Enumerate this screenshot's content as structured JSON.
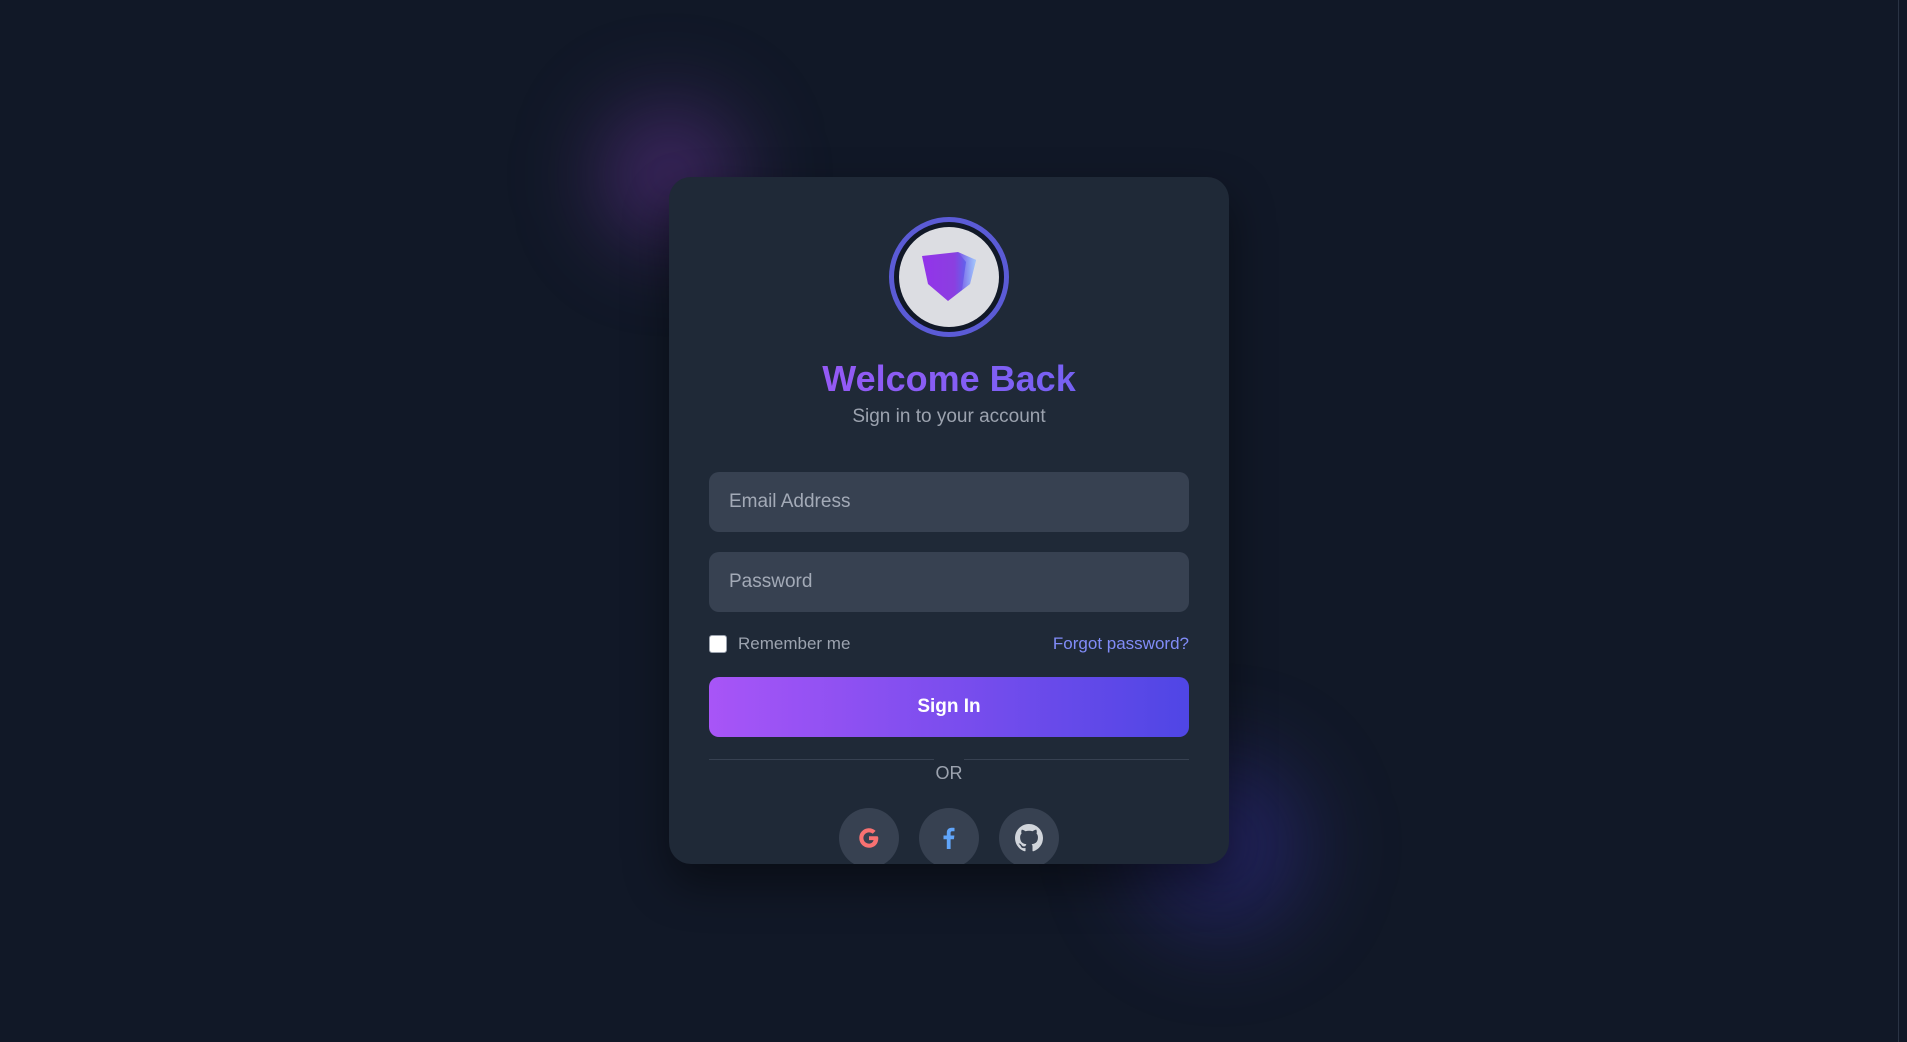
{
  "login": {
    "title": "Welcome Back",
    "subtitle": "Sign in to your account",
    "email_placeholder": "Email Address",
    "password_placeholder": "Password",
    "remember_label": "Remember me",
    "remember_checked": false,
    "forgot_label": "Forgot password?",
    "signin_label": "Sign In",
    "divider_label": "OR",
    "social_buttons": [
      {
        "icon": "google-icon",
        "color": "#f87171"
      },
      {
        "icon": "facebook-icon",
        "color": "#60a5fa"
      },
      {
        "icon": "github-icon",
        "color": "#d1d5db"
      }
    ]
  },
  "colors": {
    "background": "#111827",
    "card": "#1f2937",
    "input": "#374151",
    "accent_start": "#a855f7",
    "accent_end": "#4f46e5",
    "link": "#818cf8"
  }
}
